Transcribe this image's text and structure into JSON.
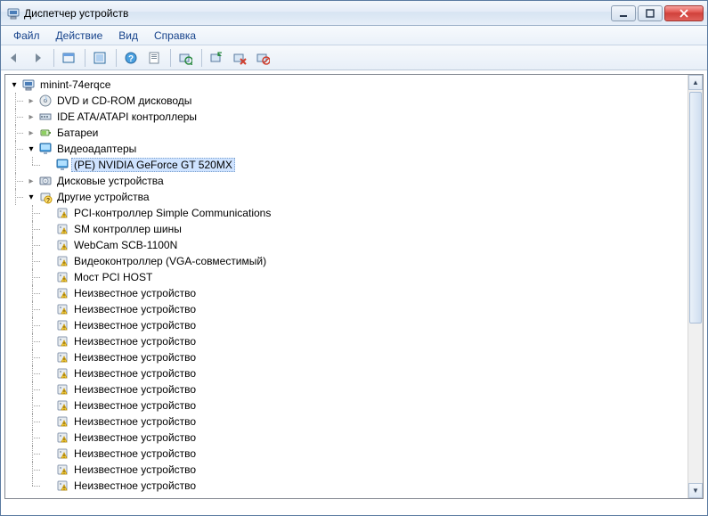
{
  "window": {
    "title": "Диспетчер устройств"
  },
  "menu": {
    "file": "Файл",
    "action": "Действие",
    "view": "Вид",
    "help": "Справка"
  },
  "tree": {
    "root": "minint-74erqce",
    "categories": [
      {
        "label": "DVD и CD-ROM дисководы",
        "icon": "cd",
        "expanded": false
      },
      {
        "label": "IDE ATA/ATAPI контроллеры",
        "icon": "ide",
        "expanded": false
      },
      {
        "label": "Батареи",
        "icon": "battery",
        "expanded": false
      },
      {
        "label": "Видеоадаптеры",
        "icon": "display",
        "expanded": true,
        "children": [
          {
            "label": "(PE) NVIDIA GeForce GT 520MX",
            "icon": "display",
            "selected": true
          }
        ]
      },
      {
        "label": "Дисковые устройства",
        "icon": "disk",
        "expanded": false
      },
      {
        "label": "Другие устройства",
        "icon": "other",
        "expanded": true,
        "children": [
          {
            "label": "PCI-контроллер Simple Communications",
            "icon": "warn"
          },
          {
            "label": "SM контроллер шины",
            "icon": "warn"
          },
          {
            "label": "WebCam SCB-1100N",
            "icon": "warn"
          },
          {
            "label": "Видеоконтроллер (VGA-совместимый)",
            "icon": "warn"
          },
          {
            "label": "Мост PCI HOST",
            "icon": "warn"
          },
          {
            "label": "Неизвестное устройство",
            "icon": "warn"
          },
          {
            "label": "Неизвестное устройство",
            "icon": "warn"
          },
          {
            "label": "Неизвестное устройство",
            "icon": "warn"
          },
          {
            "label": "Неизвестное устройство",
            "icon": "warn"
          },
          {
            "label": "Неизвестное устройство",
            "icon": "warn"
          },
          {
            "label": "Неизвестное устройство",
            "icon": "warn"
          },
          {
            "label": "Неизвестное устройство",
            "icon": "warn"
          },
          {
            "label": "Неизвестное устройство",
            "icon": "warn"
          },
          {
            "label": "Неизвестное устройство",
            "icon": "warn"
          },
          {
            "label": "Неизвестное устройство",
            "icon": "warn"
          },
          {
            "label": "Неизвестное устройство",
            "icon": "warn"
          },
          {
            "label": "Неизвестное устройство",
            "icon": "warn"
          },
          {
            "label": "Неизвестное устройство",
            "icon": "warn"
          }
        ]
      }
    ]
  }
}
